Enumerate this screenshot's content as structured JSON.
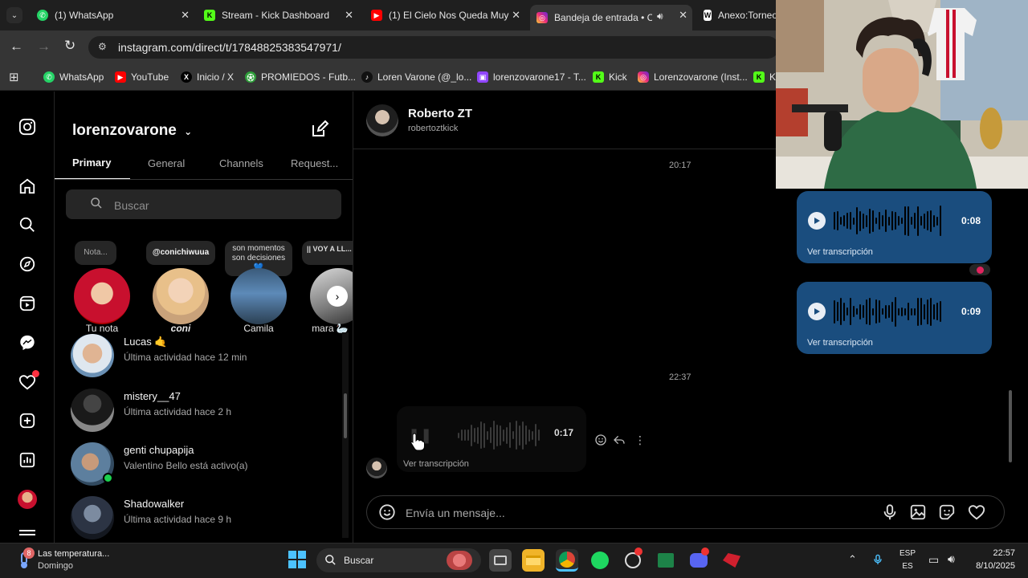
{
  "browser": {
    "tabs": [
      {
        "title": "(1) WhatsApp"
      },
      {
        "title": "Stream - Kick Dashboard"
      },
      {
        "title": "(1) El Cielo Nos Queda Muy"
      },
      {
        "title": "Bandeja de entrada • Ch"
      },
      {
        "title": "Anexo:Torneo"
      }
    ],
    "url": "instagram.com/direct/t/17848825383547971/",
    "bookmarks": [
      {
        "label": "WhatsApp",
        "color": "#25d366"
      },
      {
        "label": "YouTube",
        "color": "#ff0000"
      },
      {
        "label": "Inicio / X",
        "color": "#000000"
      },
      {
        "label": "PROMIEDOS - Futb...",
        "color": "#2e9e3a"
      },
      {
        "label": "Loren Varone (@_lo...",
        "color": "#111111"
      },
      {
        "label": "lorenzovarone17 - T...",
        "color": "#9146ff"
      },
      {
        "label": "Kick",
        "color": "#53fc18"
      },
      {
        "label": "Lorenzovarone (Inst...",
        "color": "#e1306c"
      },
      {
        "label": "K",
        "color": "#53fc18"
      }
    ]
  },
  "inbox": {
    "username": "lorenzovarone",
    "tabs": [
      {
        "label": "Primary"
      },
      {
        "label": "General"
      },
      {
        "label": "Channels"
      },
      {
        "label": "Request..."
      }
    ],
    "search_placeholder": "Buscar",
    "notes": [
      {
        "bubble": "Nota...",
        "name": "Tu nota"
      },
      {
        "bubble": "@conichiwuua",
        "name": "coni"
      },
      {
        "bubble": "son momentos son decisiones 💙",
        "name": "Camila"
      },
      {
        "bubble": "|| VOY A LL... Bad Bunn",
        "name": "mara 🦢"
      }
    ],
    "conversations": [
      {
        "name": "Lucas 🤙",
        "status": "Última actividad hace 12 min"
      },
      {
        "name": "mistery__47",
        "status": "Última actividad hace 2 h"
      },
      {
        "name": "genti chupapija",
        "status": "Valentino Bello está activo(a)"
      },
      {
        "name": "Shadowalker",
        "status": "Última actividad hace 9 h"
      }
    ]
  },
  "chat": {
    "contact_name": "Roberto ZT",
    "contact_handle": "robertoztkick",
    "time1": "20:17",
    "time2": "22:37",
    "sent_voice": [
      {
        "duration": "0:08",
        "transcription": "Ver transcripción"
      },
      {
        "duration": "0:09",
        "transcription": "Ver transcripción"
      }
    ],
    "received_voice": {
      "duration": "0:17",
      "transcription": "Ver transcripción"
    },
    "composer_placeholder": "Envía un mensaje..."
  },
  "taskbar": {
    "weather_title": "Las temperatura...",
    "weather_sub": "Domingo",
    "weather_badge": "8",
    "search_label": "Buscar",
    "lang_top": "ESP",
    "lang_bottom": "ES",
    "time": "22:57",
    "date": "8/10/2025"
  },
  "colors": {
    "sent_bubble": "#1a4d7e",
    "ig_background": "#000000",
    "browser_chrome": "#353535"
  }
}
